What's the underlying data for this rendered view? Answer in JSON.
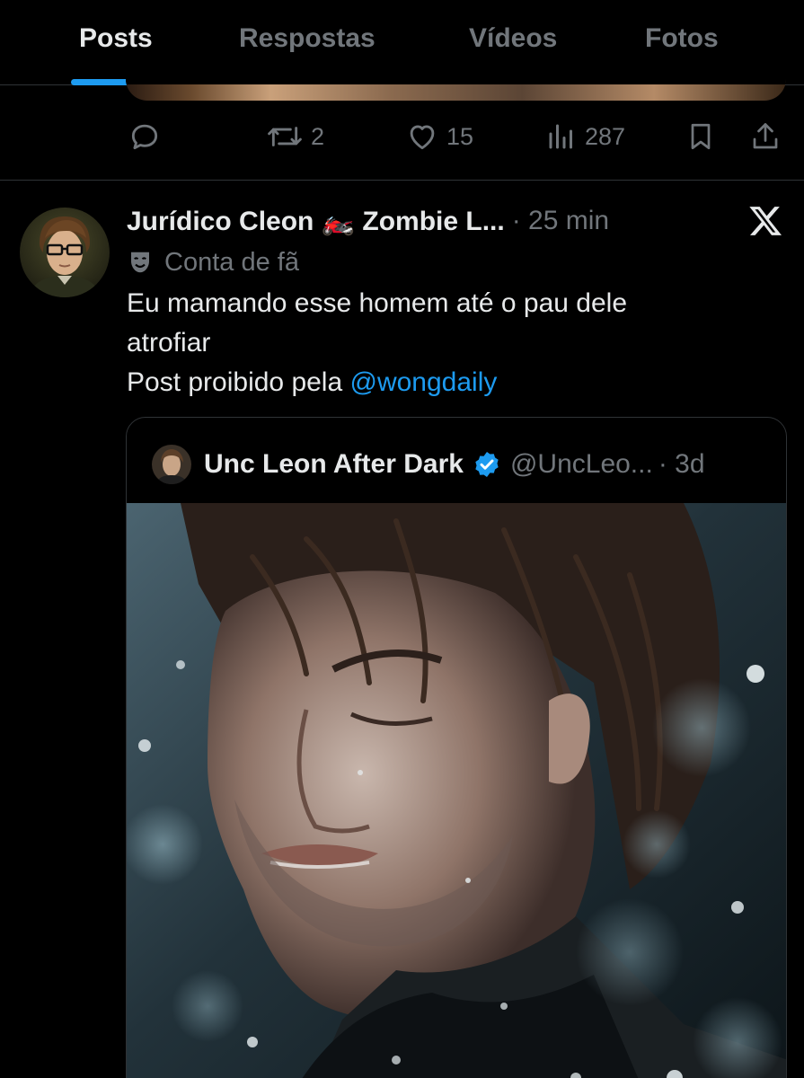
{
  "tabs": [
    {
      "label": "Posts",
      "active": true
    },
    {
      "label": "Respostas",
      "active": false
    },
    {
      "label": "Vídeos",
      "active": false
    },
    {
      "label": "Fotos",
      "active": false
    }
  ],
  "prev_post": {
    "actions": {
      "reply_icon": "reply-icon",
      "repost_icon": "repost-icon",
      "repost_count": "2",
      "like_icon": "heart-icon",
      "like_count": "15",
      "views_icon": "views-icon",
      "views_count": "287",
      "bookmark_icon": "bookmark-icon",
      "share_icon": "share-icon"
    }
  },
  "post": {
    "author": "Jurídico Cleon 🏍️ Zombie L...",
    "timestamp": "· 25 min",
    "fan_label_icon": "theater-mask-icon",
    "fan_label": "Conta de fã",
    "text_line1": "Eu mamando esse homem até o pau dele",
    "text_line2": "atrofiar",
    "text_line3_prefix": "Post proibido pela ",
    "mention": "@wongdaily",
    "badge_icon": "x-logo-icon"
  },
  "quote": {
    "author": "Unc Leon After Dark",
    "verified_icon": "verified-badge-icon",
    "handle": "@UncLeo...",
    "timestamp": "· 3d"
  },
  "colors": {
    "background": "#000000",
    "accent": "#1d9bf0",
    "text": "#e7e9ea",
    "muted": "#71767b",
    "border": "#2f3336"
  }
}
